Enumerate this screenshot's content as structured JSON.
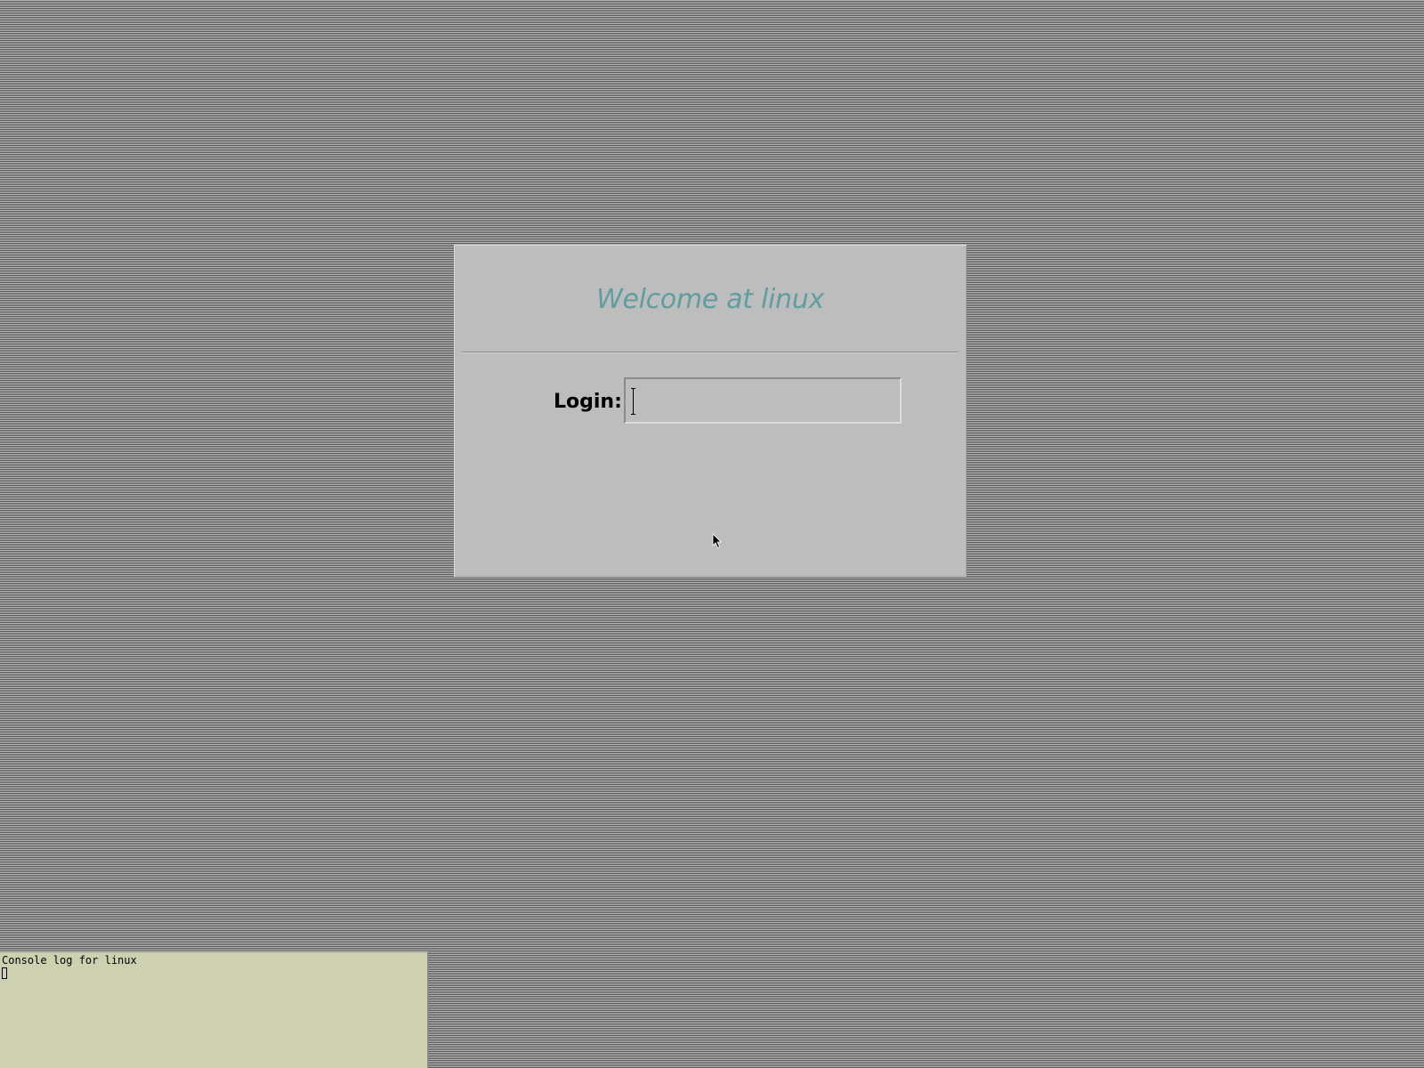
{
  "desktop": {
    "background_colors": [
      "#5a5a5a",
      "#b4b4b4"
    ]
  },
  "login_panel": {
    "greeting": "Welcome at linux",
    "greeting_color": "#5f9ea0",
    "panel_color": "#bdbdbd",
    "login_label": "Login:",
    "login_value": "",
    "caret_icon": "i-beam-cursor-icon"
  },
  "console": {
    "title": "Console log for linux",
    "background_color": "#cdd1b0",
    "caret_icon": "block-cursor-icon"
  },
  "pointer": {
    "icon": "arrow-pointer-icon"
  }
}
